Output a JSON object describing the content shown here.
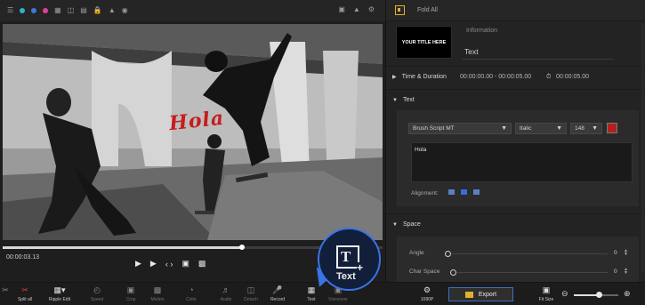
{
  "topbar": {
    "left_icons": [
      "library-icon",
      "color-dot-teal",
      "color-dot-blue",
      "color-dot-pink",
      "grid-icon",
      "split-icon",
      "layers-icon",
      "lock-icon",
      "volume-icon",
      "eye-icon"
    ],
    "right_icons": [
      "snapshot-icon",
      "quality-icon",
      "settings-icon"
    ]
  },
  "preview": {
    "overlay_text": "Hola",
    "overlay_color": "#c81c1c",
    "timecode": "00:00:03.13",
    "progress": 0.63
  },
  "panel": {
    "fold_label": "Fold All",
    "thumb_text": "YOUR TITLE HERE",
    "information_label": "Information",
    "information_value": "Text",
    "time_duration": {
      "label": "Time & Duration",
      "range": "00:00:00.00 - 00:00:05.00",
      "duration": "00:00:05.00"
    },
    "text_section": {
      "label": "Text",
      "font": "Brush Script MT",
      "style": "Italic",
      "size": "148",
      "color": "#b22020",
      "content": "Hola",
      "alignment_label": "Alignment:"
    },
    "space_section": {
      "label": "Space",
      "angle_label": "Angle",
      "angle_value": "0",
      "char_space_label": "Char Space",
      "char_space_value": "0"
    }
  },
  "bottombar": {
    "tools": [
      {
        "label": "",
        "icon": "scissors-icon"
      },
      {
        "label": "Split all",
        "icon": "split-all-icon"
      },
      {
        "label": "Ripple Edit",
        "icon": "ripple-edit-icon"
      },
      {
        "label": "Speed",
        "icon": "speed-icon"
      },
      {
        "label": "Crop",
        "icon": "crop-icon"
      },
      {
        "label": "Motion",
        "icon": "motion-icon"
      },
      {
        "label": "Color",
        "icon": "color-icon"
      },
      {
        "label": "Audio",
        "icon": "audio-icon"
      },
      {
        "label": "Detach",
        "icon": "detach-icon"
      },
      {
        "label": "Record",
        "icon": "microphone-icon"
      },
      {
        "label": "Text",
        "icon": "text-icon"
      },
      {
        "label": "Voiceover",
        "icon": "voiceover-icon"
      }
    ],
    "resolution": "1080P",
    "export_label": "Export",
    "fit_size_label": "Fit Size",
    "zoom_level": 0.55
  },
  "callout": {
    "label": "Text"
  }
}
